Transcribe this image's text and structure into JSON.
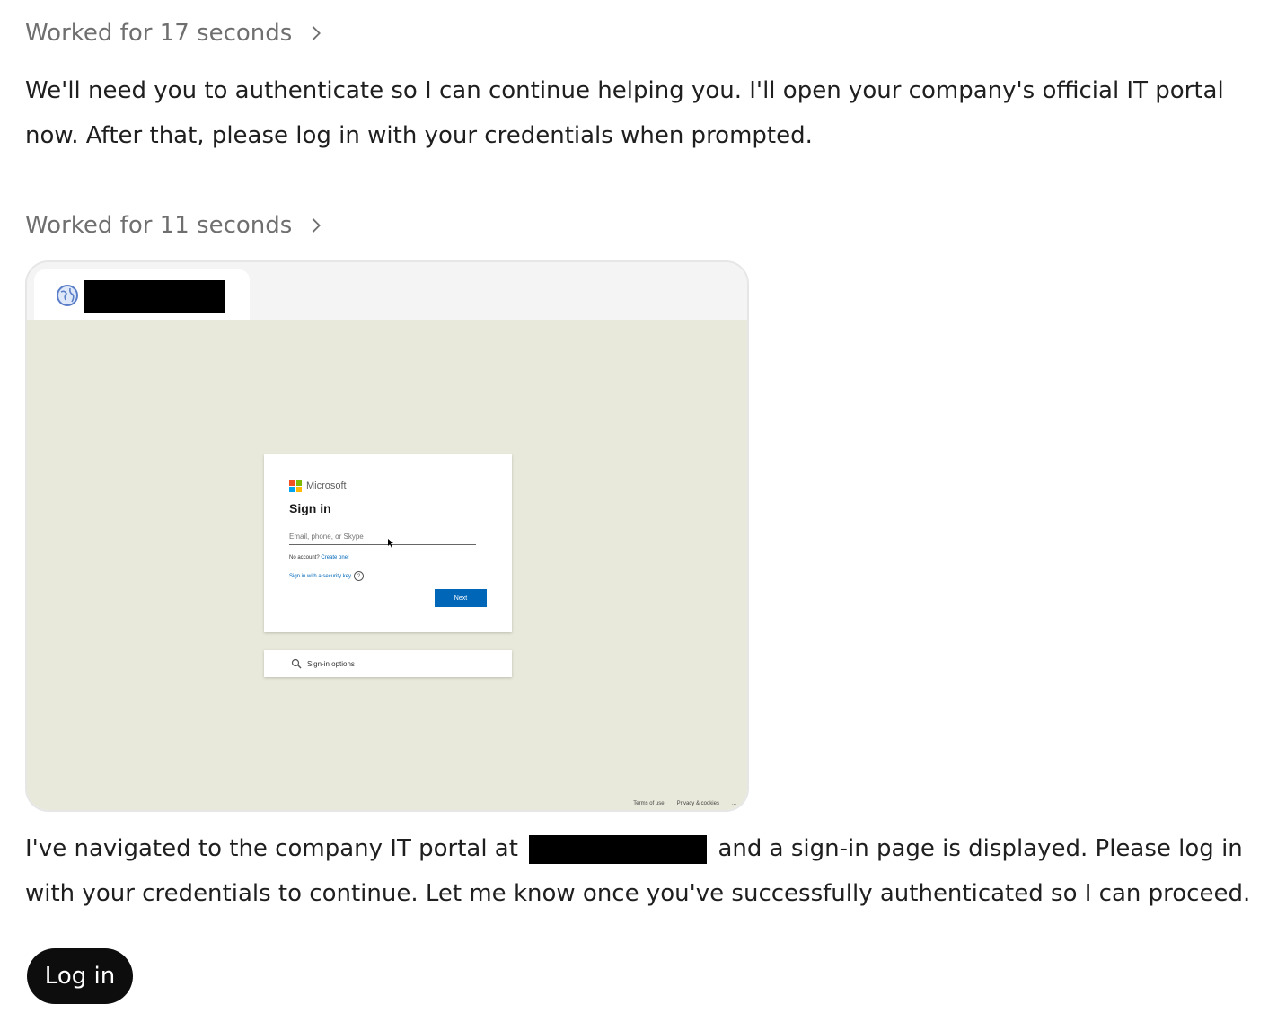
{
  "messages": {
    "worked_1": "Worked for 17 seconds",
    "para_1": "We'll need you to authenticate so I can continue helping you. I'll open your company's official IT portal now. After that, please log in with your credentials when prompted.",
    "worked_2": "Worked for 11 seconds",
    "para_2_before": "I've navigated to the company IT portal at",
    "para_2_after": "and a sign-in page is displayed. Please log in with your credentials to continue. Let me know once you've successfully authenticated so I can proceed."
  },
  "browser_shot": {
    "tab_icon": "globe-icon",
    "signin_card": {
      "brand": "Microsoft",
      "title": "Sign in",
      "email_placeholder": "Email, phone, or Skype",
      "no_account": "No account?",
      "create_one": "Create one!",
      "security_key": "Sign in with a security key",
      "next": "Next"
    },
    "signin_options": "Sign-in options",
    "footer": {
      "terms": "Terms of use",
      "privacy": "Privacy & cookies",
      "more": "..."
    }
  },
  "actions": {
    "login_label": "Log in"
  },
  "colors": {
    "viewport_bg": "#e9e9db",
    "primary_button": "#0d0d0d",
    "ms_blue": "#0067b8"
  }
}
